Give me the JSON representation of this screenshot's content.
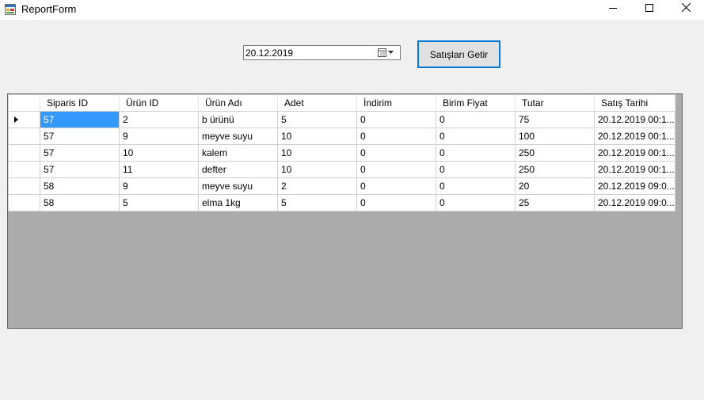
{
  "window": {
    "title": "ReportForm",
    "icons": {
      "app": "form-icon",
      "minimize": "minimize-icon",
      "maximize": "maximize-icon",
      "close": "close-icon"
    }
  },
  "filter": {
    "date_value": "20.12.2019",
    "fetch_button_label": "Satışları Getir"
  },
  "grid": {
    "columns": [
      "Siparis ID",
      "Ürün ID",
      "Ürün Adı",
      "Adet",
      "İndirim",
      "Birim Fiyat",
      "Tutar",
      "Satış Tarihi"
    ],
    "rows": [
      [
        "57",
        "2",
        "b ürünü",
        "5",
        "0",
        "0",
        "75",
        "20.12.2019 00:1..."
      ],
      [
        "57",
        "9",
        "meyve suyu",
        "10",
        "0",
        "0",
        "100",
        "20.12.2019 00:1..."
      ],
      [
        "57",
        "10",
        "kalem",
        "10",
        "0",
        "0",
        "250",
        "20.12.2019 00:1..."
      ],
      [
        "57",
        "11",
        "defter",
        "10",
        "0",
        "0",
        "250",
        "20.12.2019 00:1..."
      ],
      [
        "58",
        "9",
        "meyve suyu",
        "2",
        "0",
        "0",
        "20",
        "20.12.2019 09:0..."
      ],
      [
        "58",
        "5",
        "elma 1kg",
        "5",
        "0",
        "0",
        "25",
        "20.12.2019 09:0..."
      ]
    ],
    "selected_row": 0,
    "selected_col": 0,
    "colors": {
      "selection": "#3399ff",
      "background": "#ababab"
    }
  }
}
